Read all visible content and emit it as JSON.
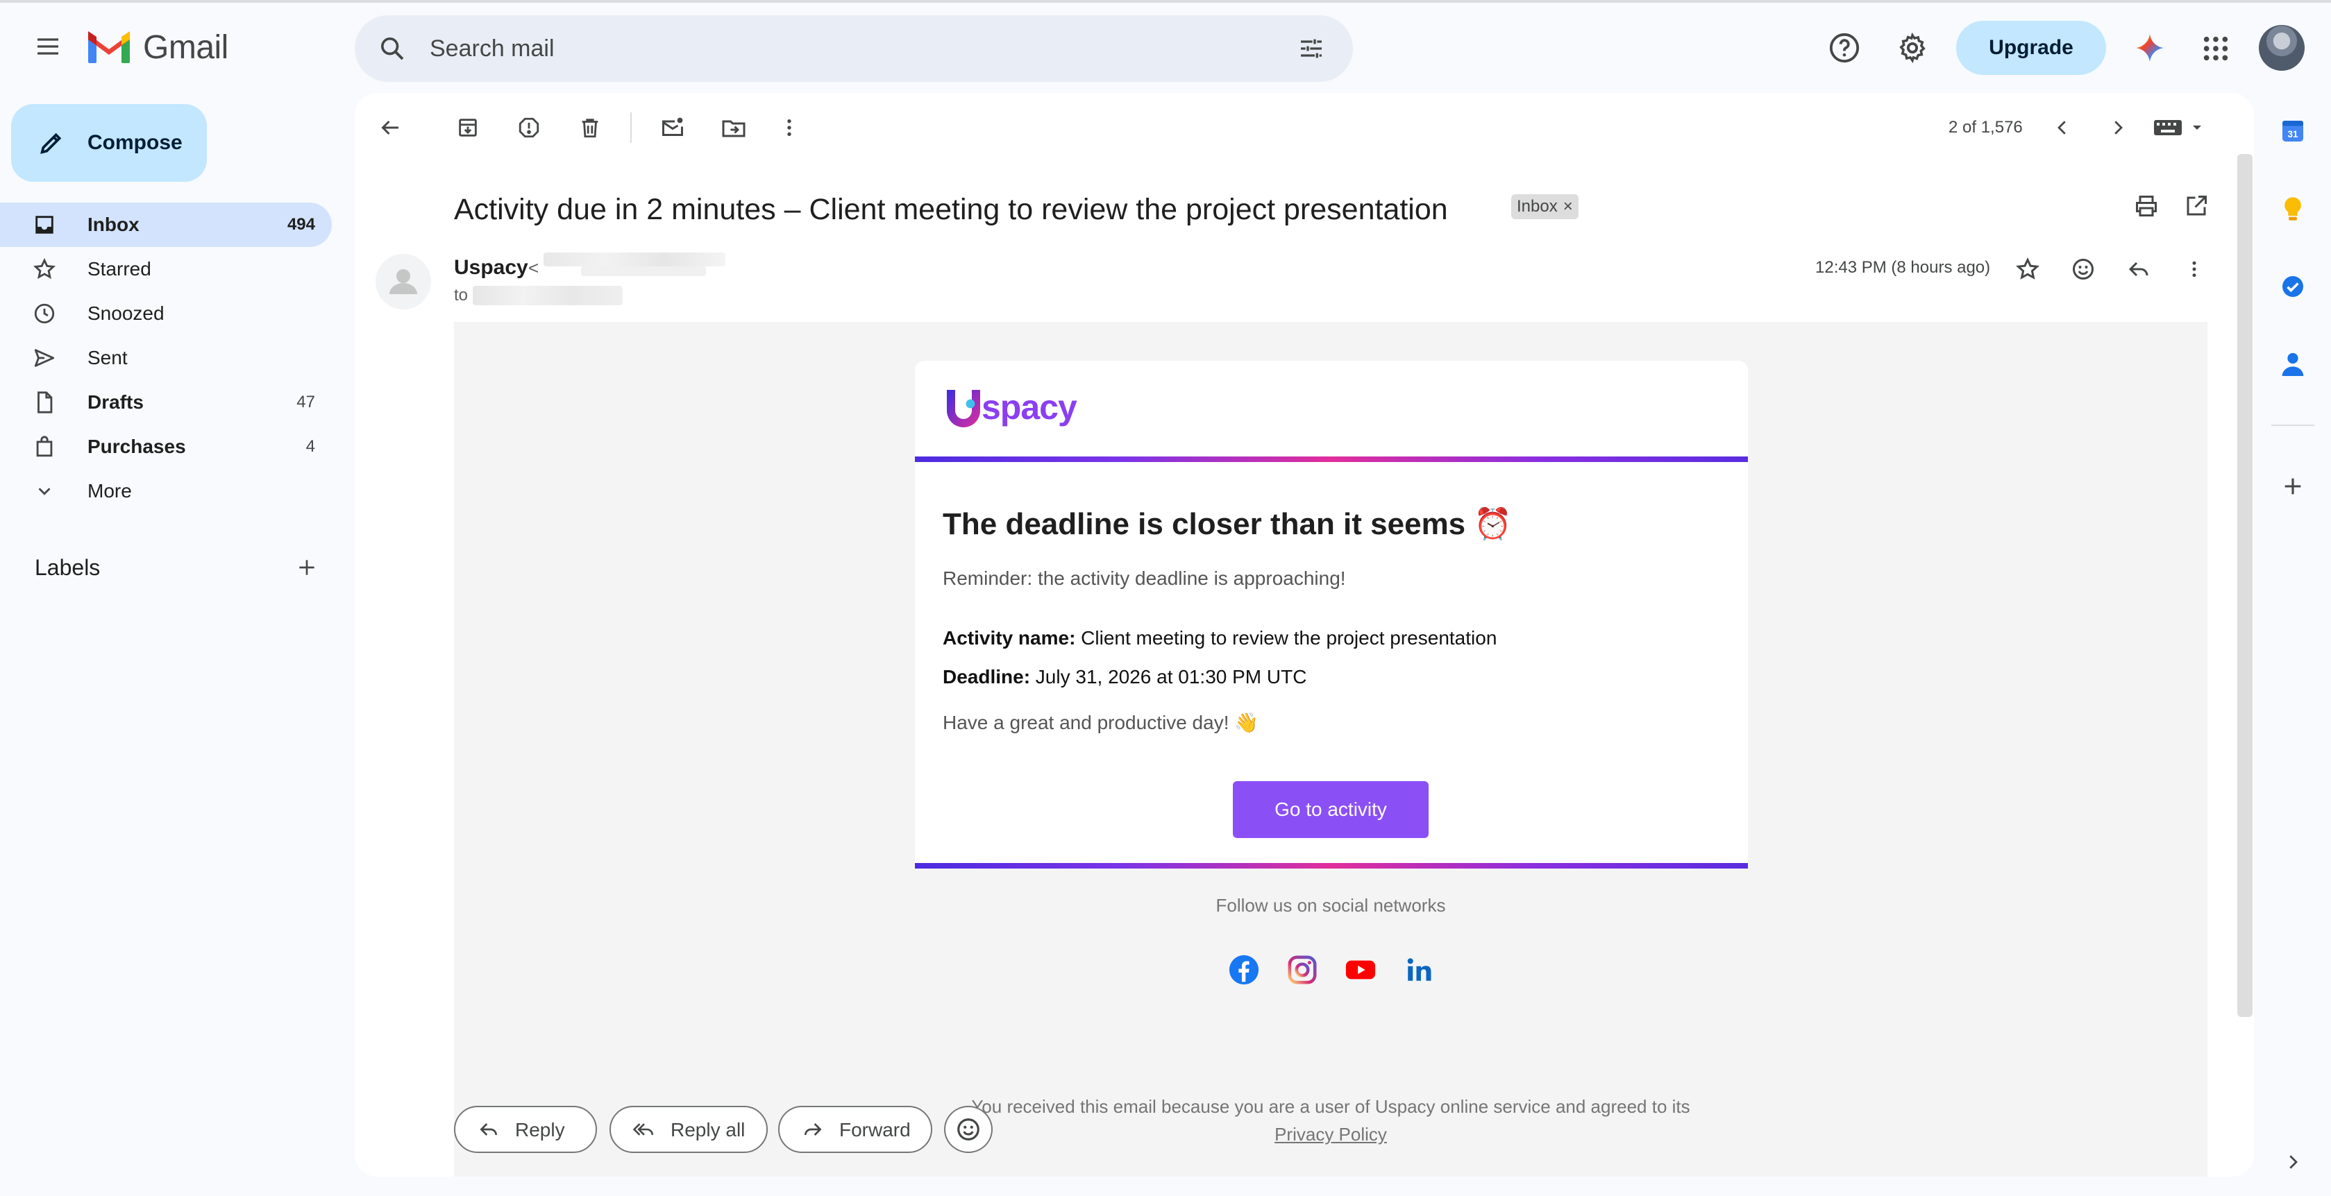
{
  "app": {
    "name": "Gmail"
  },
  "search": {
    "placeholder": "Search mail"
  },
  "header": {
    "upgrade_label": "Upgrade"
  },
  "sidebar": {
    "compose_label": "Compose",
    "items": [
      {
        "label": "Inbox",
        "count": "494"
      },
      {
        "label": "Starred",
        "count": ""
      },
      {
        "label": "Snoozed",
        "count": ""
      },
      {
        "label": "Sent",
        "count": ""
      },
      {
        "label": "Drafts",
        "count": "47"
      },
      {
        "label": "Purchases",
        "count": "4"
      },
      {
        "label": "More",
        "count": ""
      }
    ],
    "labels_heading": "Labels"
  },
  "toolbar": {
    "pager": "2 of 1,576"
  },
  "message": {
    "subject": "Activity due in 2 minutes – Client meeting to review the project presentation",
    "chip_label": "Inbox",
    "chip_close": "×",
    "sender_name": "Uspacy",
    "sender_lt": "<",
    "to_prefix": "to",
    "time": "12:43 PM (8 hours ago)"
  },
  "email": {
    "brand": "spacy",
    "heading": "The deadline is closer than it seems ⏰",
    "reminder": "Reminder: the activity deadline is approaching!",
    "activity_label": "Activity name:",
    "activity_value": " Client meeting to review the project presentation",
    "deadline_label": "Deadline:",
    "deadline_value": " July 31, 2026 at 01:30 PM UTC",
    "closing": "Have a great and productive day! 👋",
    "cta": "Go to activity",
    "follow": "Follow us on social networks",
    "footer_line": "You received this email because you are a user of Uspacy online service and agreed to its",
    "privacy_link": "Privacy Policy",
    "social_icons": [
      "facebook-icon",
      "instagram-icon",
      "youtube-icon",
      "linkedin-icon"
    ]
  },
  "reply_bar": {
    "reply": "Reply",
    "reply_all": "Reply all",
    "forward": "Forward"
  },
  "side_panel": {
    "calendar_day": "31"
  },
  "colors": {
    "accent": "#0b57d0",
    "compose_bg": "#c2e7ff",
    "active_nav": "#d3e3fd",
    "cta": "#8b4ff6",
    "brand_purple": "#8a3ff0"
  }
}
